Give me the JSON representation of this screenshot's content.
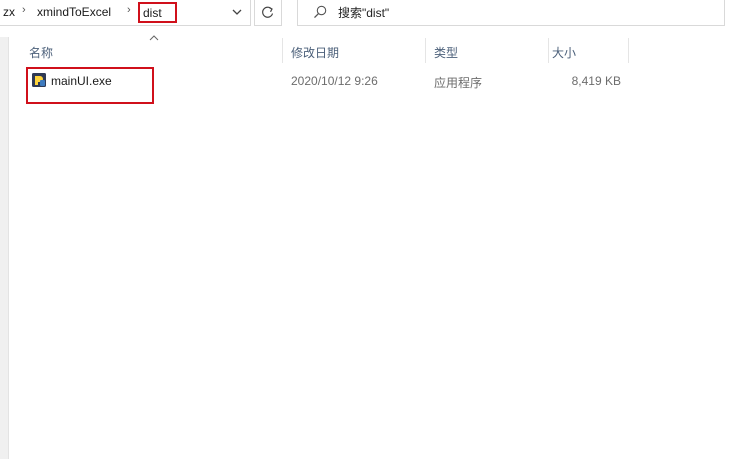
{
  "breadcrumb": {
    "items": [
      "zx",
      "xmindToExcel"
    ],
    "current": "dist",
    "separator": "›"
  },
  "search": {
    "placeholder": "搜索\"dist\""
  },
  "columns": {
    "name": "名称",
    "date": "修改日期",
    "type": "类型",
    "size": "大小"
  },
  "files": [
    {
      "name": "mainUI.exe",
      "date": "2020/10/12 9:26",
      "type": "应用程序",
      "size": "8,419 KB",
      "icon": "exe-app-icon"
    }
  ],
  "colors": {
    "highlight": "#d0101b",
    "header_text": "#4c607a"
  }
}
